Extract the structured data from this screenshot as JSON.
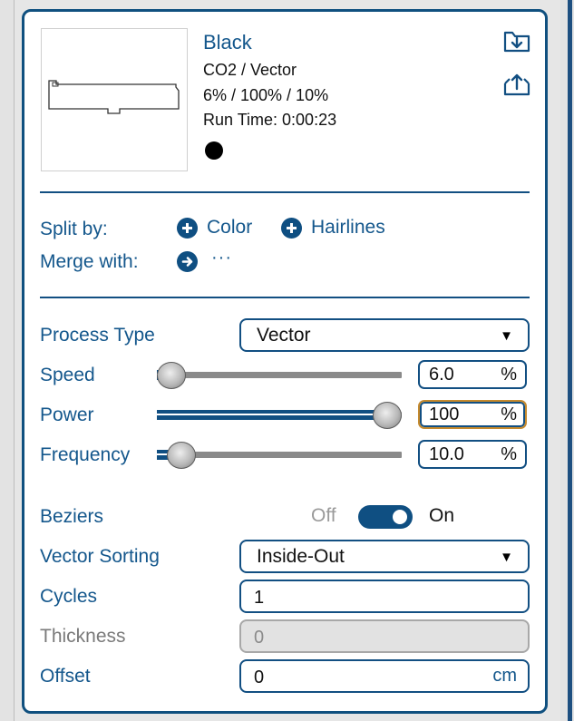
{
  "layer": {
    "name": "Black",
    "type": "CO2 / Vector",
    "settings": "6%  /  100%  /  10%",
    "run_time": "Run Time: 0:00:23",
    "color": "#000000"
  },
  "icons": {
    "import": "folder-import-icon",
    "export": "export-tray-icon",
    "plus": "plus-circle-icon",
    "merge": "arrow-right-circle-icon"
  },
  "split": {
    "label": "Split by:",
    "color_label": "Color",
    "hairlines_label": "Hairlines"
  },
  "merge": {
    "label": "Merge with:",
    "value": "···"
  },
  "process_type": {
    "label": "Process Type",
    "value": "Vector",
    "arrow": "▼"
  },
  "speed": {
    "label": "Speed",
    "value": "6.0",
    "unit": "%",
    "level": 0.06
  },
  "power": {
    "label": "Power",
    "value": "100",
    "unit": "%",
    "level": 1.0
  },
  "frequency": {
    "label": "Frequency",
    "value": "10.0",
    "unit": "%",
    "level": 0.1
  },
  "beziers": {
    "label": "Beziers",
    "off_label": "Off",
    "on_label": "On",
    "state": "on"
  },
  "vector_sorting": {
    "label": "Vector Sorting",
    "value": "Inside-Out",
    "arrow": "▼"
  },
  "cycles": {
    "label": "Cycles",
    "value": "1"
  },
  "thickness": {
    "label": "Thickness",
    "placeholder": "0"
  },
  "offset": {
    "label": "Offset",
    "value": "0",
    "unit": "cm"
  },
  "colors": {
    "accent": "#10507f",
    "label": "#14578c",
    "active_field": "#c58a2e"
  }
}
